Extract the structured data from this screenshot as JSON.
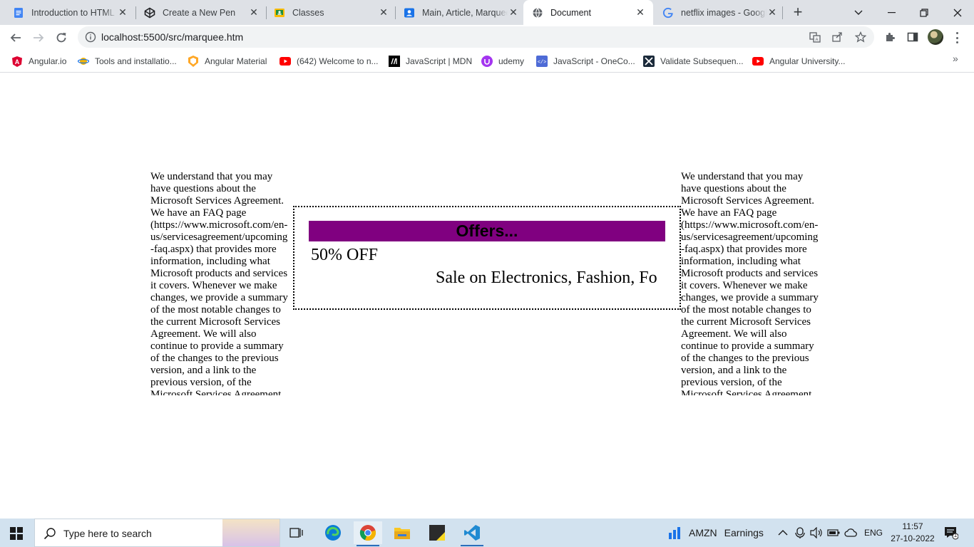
{
  "browser": {
    "tabs": [
      {
        "title": "Introduction to HTML",
        "icon": "docs-icon",
        "active": false
      },
      {
        "title": "Create a New Pen",
        "icon": "codepen-icon",
        "active": false
      },
      {
        "title": "Classes",
        "icon": "classroom-icon",
        "active": false
      },
      {
        "title": "Main, Article, Marquee",
        "icon": "contacts-icon",
        "active": false
      },
      {
        "title": "Document",
        "icon": "globe-icon",
        "active": true
      },
      {
        "title": "netflix images - Google",
        "icon": "google-icon",
        "active": false
      }
    ],
    "new_tab_glyph": "+",
    "close_glyph": "✕",
    "url": "localhost:5500/src/marquee.htm",
    "bookmarks": [
      {
        "label": "Angular.io",
        "icon": "angular-icon"
      },
      {
        "label": "Tools and installatio...",
        "icon": "orbit-icon"
      },
      {
        "label": "Angular Material",
        "icon": "angular-material-icon"
      },
      {
        "label": "(642) Welcome to n...",
        "icon": "youtube-icon"
      },
      {
        "label": "JavaScript | MDN",
        "icon": "mdn-icon"
      },
      {
        "label": "udemy",
        "icon": "udemy-icon"
      },
      {
        "label": "JavaScript - OneCo...",
        "icon": "onecompiler-icon"
      },
      {
        "label": "Validate Subsequen...",
        "icon": "hackerrank-icon"
      },
      {
        "label": "Angular University...",
        "icon": "youtube-icon"
      }
    ],
    "more_bookmarks_glyph": "»"
  },
  "page": {
    "side_text": "We understand that you may have questions about the Microsoft Services Agreement. We have an FAQ page (https://www.microsoft.com/en-us/servicesagreement/upcoming-faq.aspx) that provides more information, including what Microsoft products and services it covers. Whenever we make changes, we provide a summary of the most notable changes to the current Microsoft Services Agreement. We will also continue to provide a summary of the changes to the previous version, and a link to the previous version, of the Microsoft Services Agreement.",
    "offers_title": "Offers...",
    "offer_line_1": "50% OFF",
    "offer_line_2": "Sale on Electronics, Fashion, Fo",
    "colors": {
      "offers_bg": "#800080"
    }
  },
  "taskbar": {
    "search_placeholder": "Type here to search",
    "weather_label": "AMZN",
    "weather_text": "Earnings",
    "language": "ENG",
    "time": "11:57",
    "date": "27-10-2022",
    "notification_count": "1"
  }
}
